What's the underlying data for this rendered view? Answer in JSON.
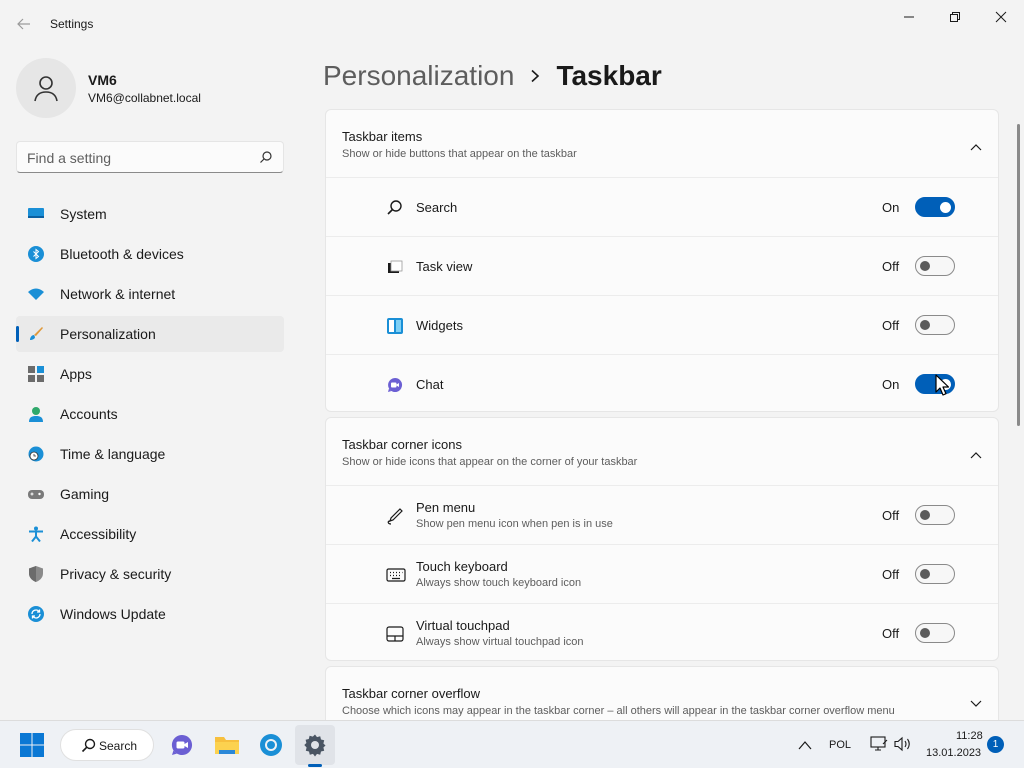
{
  "window": {
    "title": "Settings"
  },
  "user": {
    "name": "VM6",
    "email": "VM6@collabnet.local"
  },
  "search": {
    "placeholder": "Find a setting"
  },
  "sidebar": {
    "items": [
      {
        "label": "System",
        "icon": "system-icon"
      },
      {
        "label": "Bluetooth & devices",
        "icon": "bluetooth-icon"
      },
      {
        "label": "Network & internet",
        "icon": "wifi-icon"
      },
      {
        "label": "Personalization",
        "icon": "brush-icon",
        "selected": true
      },
      {
        "label": "Apps",
        "icon": "apps-icon"
      },
      {
        "label": "Accounts",
        "icon": "accounts-icon"
      },
      {
        "label": "Time & language",
        "icon": "clock-globe-icon"
      },
      {
        "label": "Gaming",
        "icon": "gamepad-icon"
      },
      {
        "label": "Accessibility",
        "icon": "accessibility-icon"
      },
      {
        "label": "Privacy & security",
        "icon": "shield-icon"
      },
      {
        "label": "Windows Update",
        "icon": "update-icon"
      }
    ]
  },
  "header": {
    "parent": "Personalization",
    "current": "Taskbar"
  },
  "taskbar_items": {
    "title": "Taskbar items",
    "subtitle": "Show or hide buttons that appear on the taskbar",
    "rows": [
      {
        "label": "Search",
        "state": "On",
        "on": true,
        "icon": "search-icon"
      },
      {
        "label": "Task view",
        "state": "Off",
        "on": false,
        "icon": "task-view-icon"
      },
      {
        "label": "Widgets",
        "state": "Off",
        "on": false,
        "icon": "widgets-icon"
      },
      {
        "label": "Chat",
        "state": "On",
        "on": true,
        "icon": "chat-icon"
      }
    ]
  },
  "corner_icons": {
    "title": "Taskbar corner icons",
    "subtitle": "Show or hide icons that appear on the corner of your taskbar",
    "rows": [
      {
        "label": "Pen menu",
        "description": "Show pen menu icon when pen is in use",
        "state": "Off",
        "on": false,
        "icon": "pen-icon"
      },
      {
        "label": "Touch keyboard",
        "description": "Always show touch keyboard icon",
        "state": "Off",
        "on": false,
        "icon": "keyboard-icon"
      },
      {
        "label": "Virtual touchpad",
        "description": "Always show virtual touchpad icon",
        "state": "Off",
        "on": false,
        "icon": "touchpad-icon"
      }
    ]
  },
  "corner_overflow": {
    "title": "Taskbar corner overflow",
    "subtitle": "Choose which icons may appear in the taskbar corner – all others will appear in the taskbar corner overflow menu"
  },
  "taskbar": {
    "search_label": "Search",
    "language": "POL",
    "time": "11:28",
    "date": "13.01.2023",
    "notification_count": "1"
  },
  "colors": {
    "accent": "#005fb8",
    "background": "#f3f3f3",
    "card": "#fbfbfb"
  }
}
